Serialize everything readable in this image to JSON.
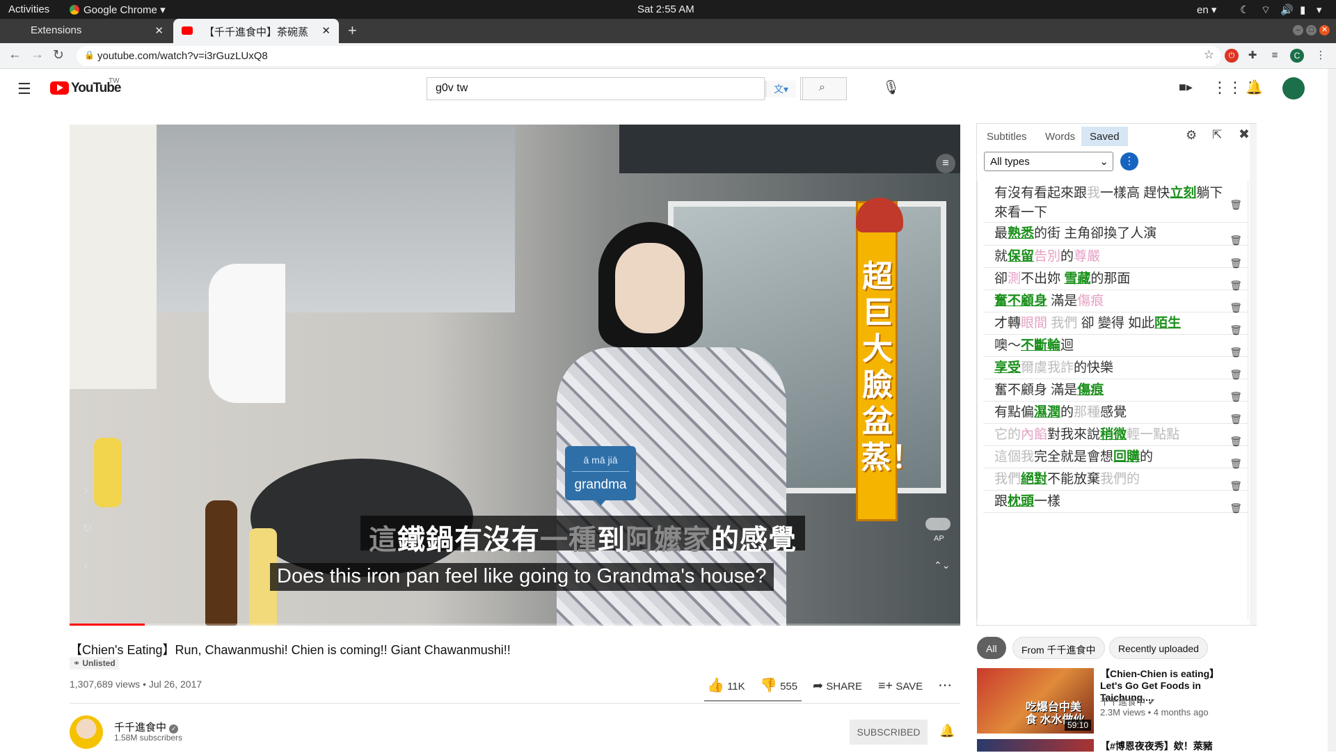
{
  "os_bar": {
    "activities": "Activities",
    "app_name": "Google Chrome",
    "clock": "Sat  2:55 AM",
    "lang": "en"
  },
  "tabs": [
    {
      "title": "Extensions"
    },
    {
      "title": "【千千進食中】茶碗蒸快"
    }
  ],
  "address_bar": {
    "url": "youtube.com/watch?v=i3rGuzLUxQ8"
  },
  "youtube": {
    "logo_text": "YouTube",
    "logo_region": "TW",
    "search_value": "g0v tw"
  },
  "video_overlay": {
    "chinese_subtitle": [
      {
        "t": "這",
        "c": "dim"
      },
      {
        "t": "鐵鍋有沒有",
        "c": ""
      },
      {
        "t": "一種",
        "c": "dim"
      },
      {
        "t": "到",
        "c": ""
      },
      {
        "t": "阿嬤家",
        "c": "dim"
      },
      {
        "t": "的感覺",
        "c": ""
      }
    ],
    "english_subtitle": "Does this iron pan feel like going to Grandma's house?",
    "popup_pinyin": "ā mā jiā",
    "popup_translation": "grandma",
    "banner_text": "超巨大臉盆蒸！",
    "toggle_label": "AP"
  },
  "panel": {
    "tabs": [
      "Subtitles",
      "Words",
      "Saved"
    ],
    "active_tab": "Saved",
    "filter_selected": "All types",
    "rows": [
      [
        {
          "t": "有沒有看起來跟",
          "c": ""
        },
        {
          "t": "我",
          "c": "dim"
        },
        {
          "t": "一樣高 趕快",
          "c": ""
        },
        {
          "t": "立刻",
          "c": "hl"
        },
        {
          "t": "躺下來看一下",
          "c": ""
        }
      ],
      [
        {
          "t": "最",
          "c": ""
        },
        {
          "t": "熟悉",
          "c": "hl"
        },
        {
          "t": "的街 主角卻換了人演",
          "c": ""
        }
      ],
      [
        {
          "t": "就",
          "c": ""
        },
        {
          "t": "保留",
          "c": "hl"
        },
        {
          "t": "告別",
          "c": "pink"
        },
        {
          "t": "的",
          "c": ""
        },
        {
          "t": "尊嚴",
          "c": "pink"
        }
      ],
      [
        {
          "t": "卻",
          "c": ""
        },
        {
          "t": "測",
          "c": "pink"
        },
        {
          "t": "不出妳 ",
          "c": ""
        },
        {
          "t": "雪藏",
          "c": "hl"
        },
        {
          "t": "的那面",
          "c": ""
        }
      ],
      [
        {
          "t": "奮不顧身",
          "c": "hl"
        },
        {
          "t": " 滿是",
          "c": ""
        },
        {
          "t": "傷痕",
          "c": "pink"
        }
      ],
      [
        {
          "t": "才轉",
          "c": ""
        },
        {
          "t": "眼間",
          "c": "pink"
        },
        {
          "t": " 我們 ",
          "c": "dim"
        },
        {
          "t": "卻 變得 如此",
          "c": ""
        },
        {
          "t": "陌生",
          "c": "hl"
        }
      ],
      [
        {
          "t": "噢～",
          "c": ""
        },
        {
          "t": "不斷輪",
          "c": "hl"
        },
        {
          "t": "迴",
          "c": ""
        }
      ],
      [
        {
          "t": "享受",
          "c": "hl"
        },
        {
          "t": "爾虞我詐",
          "c": "dim"
        },
        {
          "t": "的快樂",
          "c": ""
        }
      ],
      [
        {
          "t": "奮不顧身 滿是",
          "c": ""
        },
        {
          "t": "傷痕",
          "c": "hl"
        }
      ],
      [
        {
          "t": "有點偏",
          "c": ""
        },
        {
          "t": "濕潤",
          "c": "hl"
        },
        {
          "t": "的",
          "c": ""
        },
        {
          "t": "那種",
          "c": "dim"
        },
        {
          "t": "感覺",
          "c": ""
        }
      ],
      [
        {
          "t": "它的",
          "c": "dim"
        },
        {
          "t": "內餡",
          "c": "pink"
        },
        {
          "t": "對我來說",
          "c": ""
        },
        {
          "t": "稍微",
          "c": "hl"
        },
        {
          "t": "輕一點點",
          "c": "dim"
        }
      ],
      [
        {
          "t": "這個我",
          "c": "dim"
        },
        {
          "t": "完全就是會想",
          "c": ""
        },
        {
          "t": "回購",
          "c": "hl"
        },
        {
          "t": "的",
          "c": ""
        }
      ],
      [
        {
          "t": "我們",
          "c": "dim"
        },
        {
          "t": "絕對",
          "c": "hl"
        },
        {
          "t": "不能放棄",
          "c": ""
        },
        {
          "t": "我們的",
          "c": "dim"
        }
      ],
      [
        {
          "t": "跟",
          "c": ""
        },
        {
          "t": "枕頭",
          "c": "hl"
        },
        {
          "t": "一樣",
          "c": ""
        }
      ]
    ]
  },
  "video_info": {
    "title": "【Chien's Eating】Run, Chawanmushi! Chien is coming!! Giant Chawanmushi!!",
    "badge": "Unlisted",
    "stats": "1,307,689 views • Jul 26, 2017",
    "likes": "11K",
    "dislikes": "555",
    "share_label": "SHARE",
    "save_label": "SAVE",
    "channel_name": "千千進食中",
    "subscribers": "1.58M subscribers",
    "subscribed_label": "SUBSCRIBED"
  },
  "chips": [
    "All",
    "From 千千進食中",
    "Recently uploaded"
  ],
  "recommendations": [
    {
      "title": "【Chien-Chien is eating】Let's Go Get Foods in Taichung,...",
      "channel": "千千進食中",
      "meta": "2.3M views • 4 months ago",
      "duration": "59:10",
      "thumb_text": "吃爆台中美食 水水做伙"
    },
    {
      "title": "【#博恩夜夜秀】欸！萊豬",
      "channel": "",
      "meta": "",
      "duration": "",
      "thumb_text": ""
    }
  ],
  "colors": {
    "yt_red": "#ff0000",
    "highlight_green": "#1a8f1a",
    "popup_blue": "#2f6fa8",
    "banner_yellow": "#f5b400"
  }
}
